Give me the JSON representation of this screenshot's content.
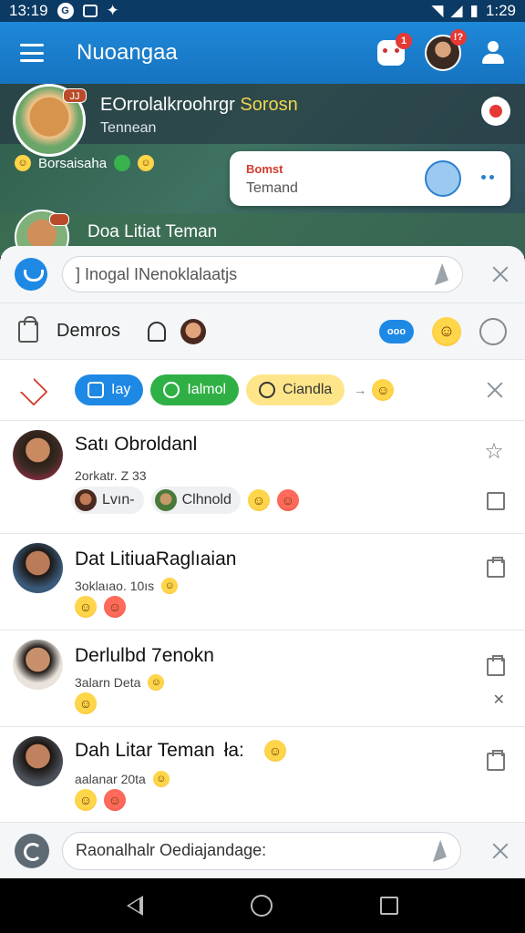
{
  "status_bar": {
    "time_left": "13:19",
    "time_right": "1:29"
  },
  "app_bar": {
    "title": "Nuoangaa",
    "badge_1": "1",
    "badge_2": "!?"
  },
  "background": {
    "header_title_main": "EOrrolalkroohrgr",
    "header_title_highlight": "Sorosn",
    "header_subtitle": "Tennean",
    "avatar_badge": "JJ",
    "status_line": "Borsaisaha",
    "card_title": "Bomst",
    "card_subtitle": "Temand",
    "row2_title": "Doa Litiat Teman"
  },
  "search": {
    "value": "] Inogal INenoklalaatjs"
  },
  "tabs": {
    "label": "Demros",
    "pill": "ooo"
  },
  "filters": {
    "chips": [
      {
        "label": "Iay",
        "color": "#1e88e5"
      },
      {
        "label": "Ialmol",
        "color": "#2fb045"
      },
      {
        "label": "Ciandla",
        "color": "#ffe58a"
      }
    ],
    "arrow": "→"
  },
  "contacts": [
    {
      "name": "Satı Obroldanl",
      "meta": "2orkatr. Z 33",
      "chip_1": "Lvın-",
      "chip_2": "Clhnold"
    },
    {
      "name": "Dat LitiuaRaglıaian",
      "meta": "3oklaıao. 10ıs"
    },
    {
      "name": "Derlulbd 7enokn",
      "meta": "3alarn Deta"
    },
    {
      "name": "Dah Litar Teman",
      "name_suffix": "ła:",
      "meta": "aalanar 20ta"
    }
  ],
  "compose": {
    "value": "Raonalhalr Oediajandage:"
  },
  "colors": {
    "app_bar": "#1e88d8",
    "accent_blue": "#1e88e5",
    "accent_red": "#e53935"
  }
}
